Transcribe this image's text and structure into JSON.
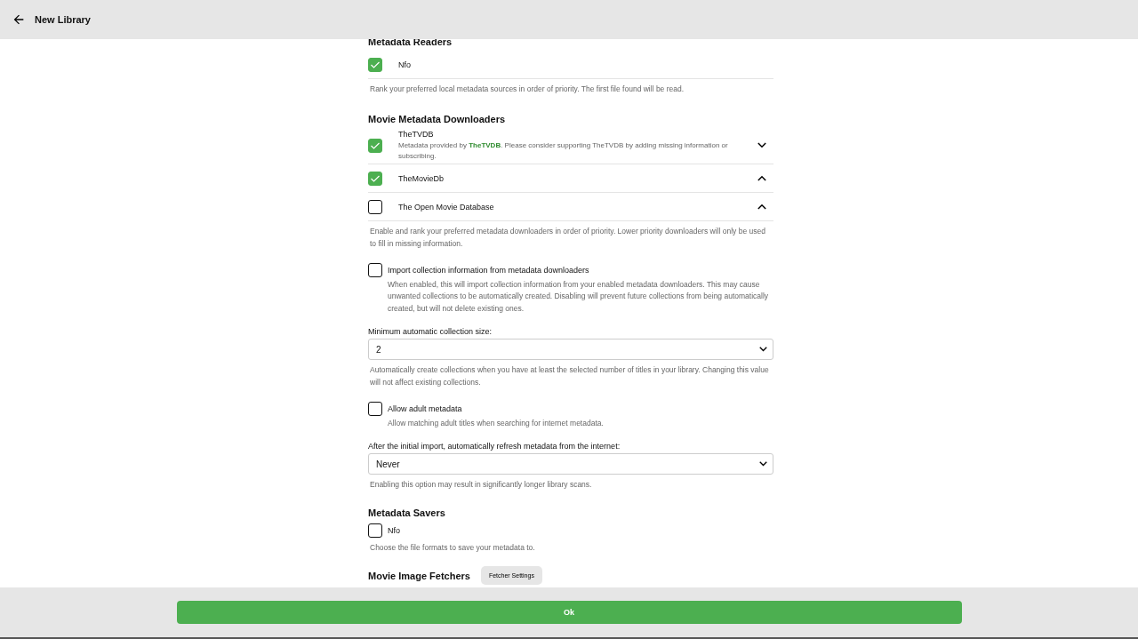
{
  "header": {
    "title": "New Library"
  },
  "readers": {
    "heading": "Metadata Readers",
    "items": [
      {
        "name": "Nfo",
        "checked": true
      }
    ],
    "description": "Rank your preferred local metadata sources in order of priority. The first file found will be read."
  },
  "downloaders": {
    "heading": "Movie Metadata Downloaders",
    "items": [
      {
        "name": "TheTVDB",
        "checked": true,
        "expanded": false,
        "description": "Metadata provided by **TheTVDB**. Please consider supporting TheTVDB by adding missing information or subscribing."
      },
      {
        "name": "TheMovieDb",
        "checked": true,
        "expanded": true
      },
      {
        "name": "The Open Movie Database",
        "checked": false,
        "expanded": true
      }
    ],
    "description": "Enable and rank your preferred metadata downloaders in order of priority. Lower priority downloaders will only be used to fill in missing information."
  },
  "options": [
    {
      "kind": "checkbox",
      "label": "Import collection information from metadata downloaders",
      "checked": false,
      "description": "When enabled, this will import collection information from your enabled metadata downloaders. This may cause unwanted collections to be automatically created. Disabling will prevent future collections from being automatically created, but will not delete existing ones."
    },
    {
      "kind": "select",
      "label": "Minimum automatic collection size:",
      "value": "2",
      "description": "Automatically create collections when you have at least the selected number of titles in your library. Changing this value will not affect existing collections."
    },
    {
      "kind": "checkbox",
      "label": "Allow adult metadata",
      "checked": false,
      "description": "Allow matching adult titles when searching for internet metadata."
    },
    {
      "kind": "select",
      "label": "After the initial import, automatically refresh metadata from the internet:",
      "value": "Never",
      "description": "Enabling this option may result in significantly longer library scans."
    }
  ],
  "savers": {
    "heading": "Metadata Savers",
    "items": [
      {
        "name": "Nfo",
        "checked": false
      }
    ],
    "description": "Choose the file formats to save your metadata to."
  },
  "fetchers": {
    "heading": "Movie Image Fetchers",
    "button": "Fetcher Settings"
  },
  "footer": {
    "button": "Ok"
  }
}
